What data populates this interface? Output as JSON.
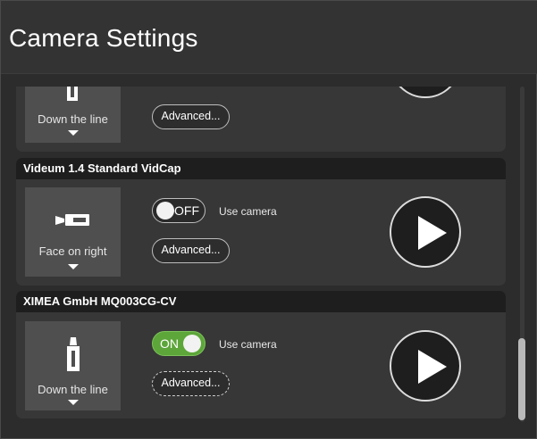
{
  "window": {
    "title": "Camera Settings"
  },
  "cameras": [
    {
      "name": "",
      "position_label": "Down the line",
      "toggle_state": "",
      "use_camera_label": "",
      "advanced_label": "Advanced...",
      "position_icon": "camera-down-the-line-icon"
    },
    {
      "name": "Videum 1.4 Standard VidCap",
      "position_label": "Face on right",
      "toggle_state": "OFF",
      "use_camera_label": "Use camera",
      "advanced_label": "Advanced...",
      "position_icon": "camera-face-on-right-icon"
    },
    {
      "name": "XIMEA GmbH MQ003CG-CV",
      "position_label": "Down the line",
      "toggle_state": "ON",
      "use_camera_label": "Use camera",
      "advanced_label": "Advanced...",
      "position_icon": "camera-down-the-line-icon"
    }
  ],
  "colors": {
    "accent_on": "#5da63a",
    "header_bg": "#1e1e1e",
    "card_bg": "#373737"
  }
}
